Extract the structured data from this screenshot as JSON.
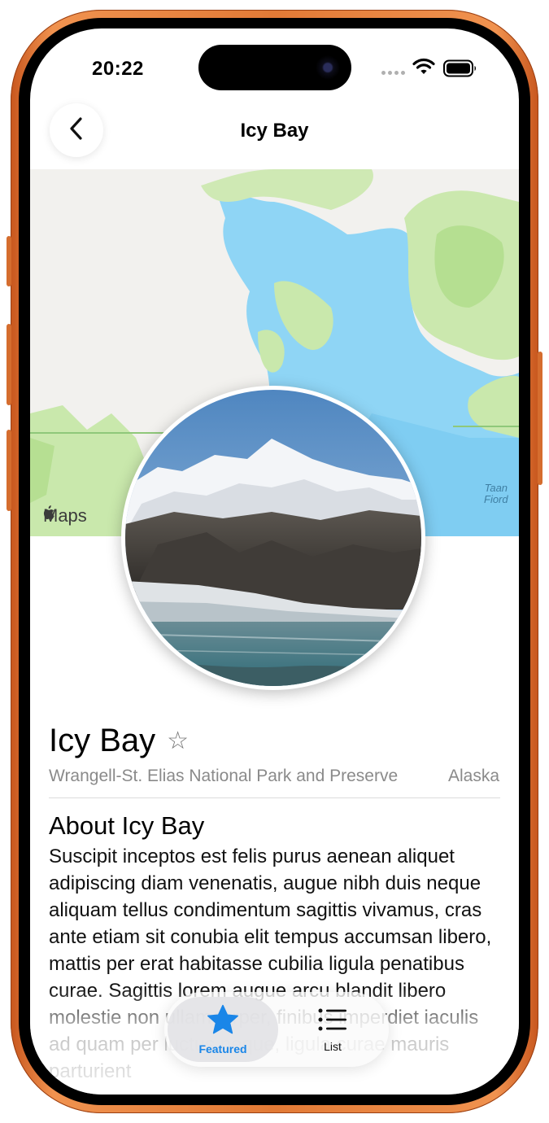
{
  "status": {
    "time": "20:22"
  },
  "nav": {
    "title": "Icy Bay"
  },
  "map": {
    "provider_label": "Maps",
    "place_label_line1": "Taan",
    "place_label_line2": "Fiord"
  },
  "place": {
    "name": "Icy Bay",
    "park": "Wrangell-St. Elias National Park and Preserve",
    "state": "Alaska"
  },
  "about": {
    "heading": "About Icy Bay",
    "body": "Suscipit inceptos est felis purus aenean aliquet adipiscing diam venenatis, augue nibh duis neque aliquam tellus condimentum sagittis vivamus, cras ante etiam sit conubia elit tempus accumsan libero, mattis per erat habitasse cubilia ligula penatibus curae. Sagittis lorem augue arcu blandit libero molestie non ullamcorper, finibus imperdiet iaculis ad quam per luctus neque, ligula curae mauris parturient"
  },
  "tabs": [
    {
      "label": "Featured",
      "icon": "star-fill-icon",
      "selected": true
    },
    {
      "label": "List",
      "icon": "list-icon",
      "selected": false
    }
  ],
  "colors": {
    "accent": "#1a86e8",
    "water": "#8fd5f5",
    "land_green": "#bfe49d",
    "frame": "#e27a36"
  }
}
